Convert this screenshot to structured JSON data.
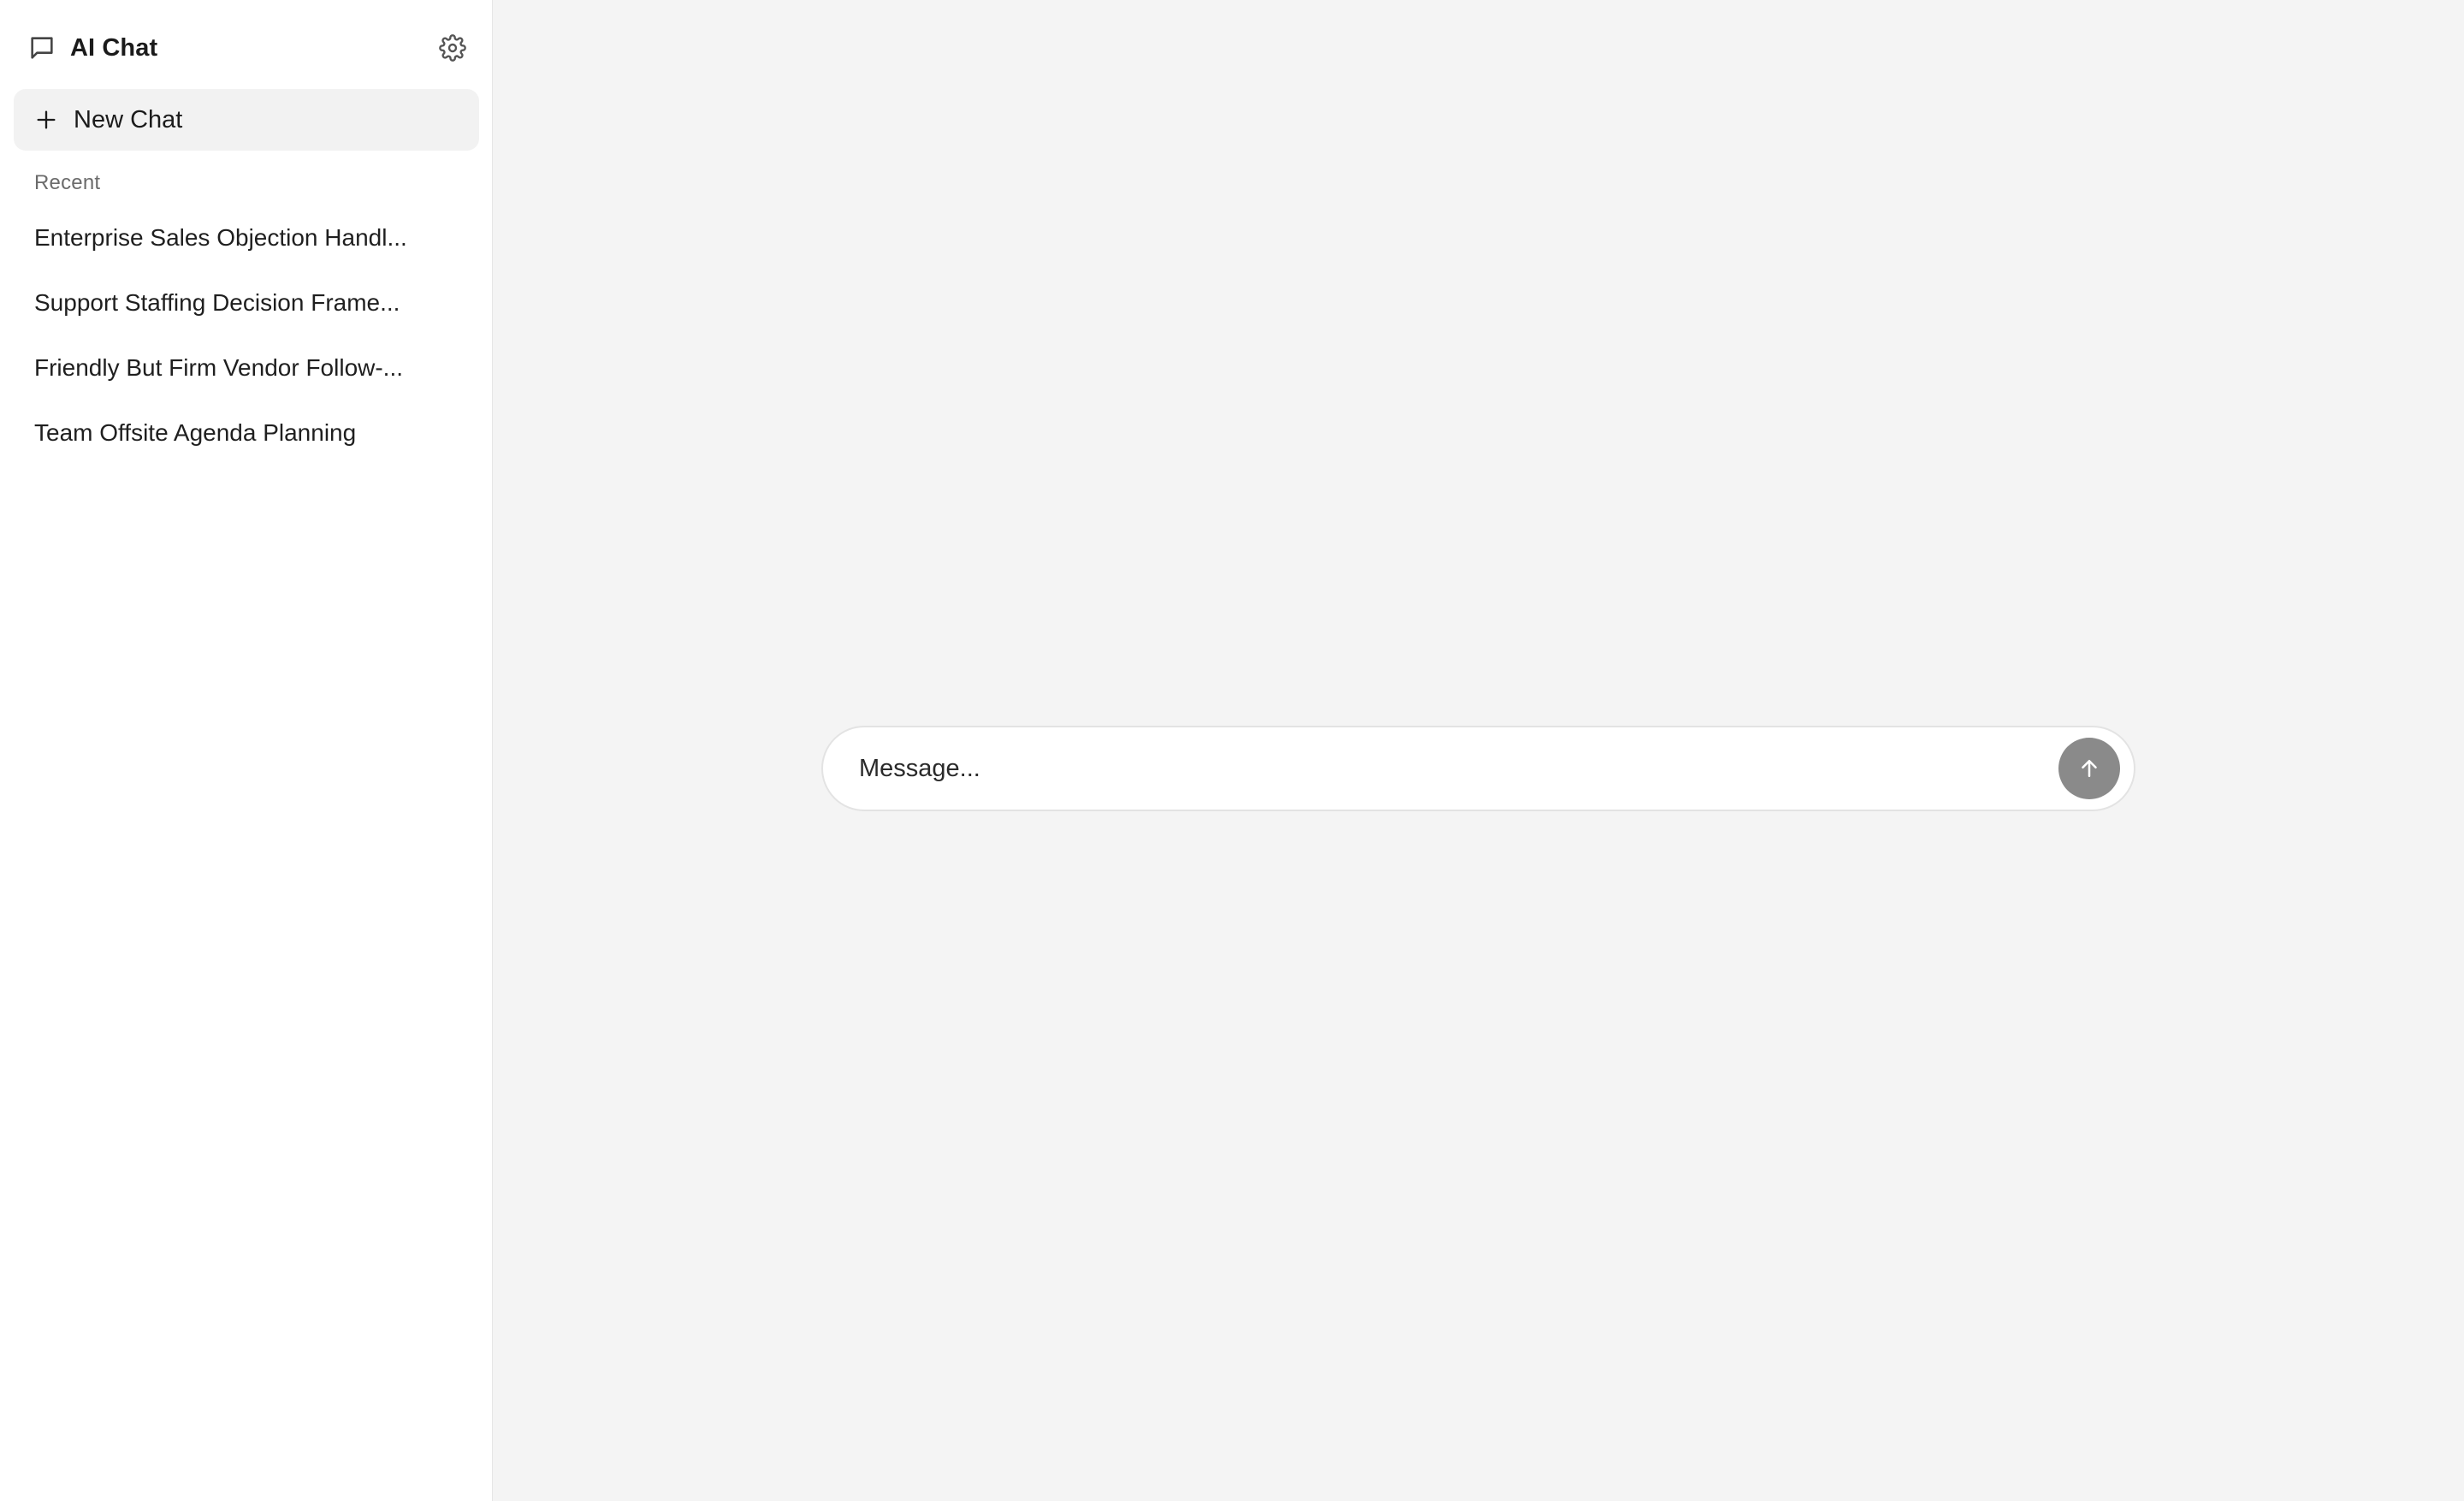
{
  "app": {
    "title": "AI Chat",
    "icon": "chat-bubble-icon"
  },
  "sidebar": {
    "settings_icon": "gear-icon",
    "new_chat": {
      "label": "New Chat",
      "icon": "plus-icon"
    },
    "recent_label": "Recent",
    "recent": [
      {
        "label": "Enterprise Sales Objection Handl..."
      },
      {
        "label": "Support Staffing Decision Frame..."
      },
      {
        "label": "Friendly But Firm Vendor Follow-..."
      },
      {
        "label": "Team Offsite Agenda Planning"
      }
    ]
  },
  "composer": {
    "placeholder": "Message...",
    "value": "",
    "send_icon": "arrow-up-icon"
  },
  "colors": {
    "sidebar_bg": "#ffffff",
    "main_bg": "#f4f4f4",
    "new_chat_bg": "#f2f2f2",
    "send_button_bg": "#8a8a8a",
    "text": "#1f1f1f",
    "muted_text": "#6b6b6b"
  }
}
